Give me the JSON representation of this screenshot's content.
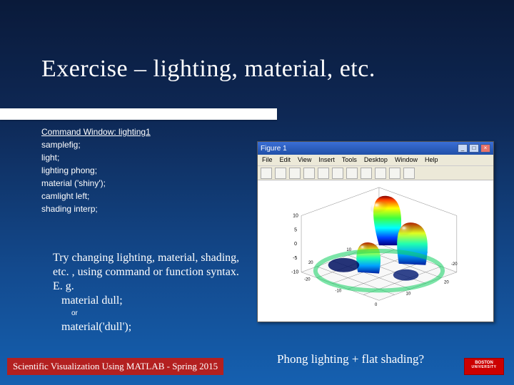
{
  "title": "Exercise – lighting, material, etc.",
  "command_window": {
    "heading": "Command Window: lighting1",
    "lines": [
      "samplefig;",
      "light;",
      "lighting phong;",
      "material ('shiny');",
      "camlight left;",
      "shading interp;"
    ]
  },
  "tip": {
    "body": "Try changing lighting, material, shading, etc. , using command or function syntax.  E. g.",
    "example1": "material dull;",
    "or_label": "or",
    "example2": "material('dull');"
  },
  "figure_window": {
    "title": "Figure 1",
    "menus": [
      "File",
      "Edit",
      "View",
      "Insert",
      "Tools",
      "Desktop",
      "Window",
      "Help"
    ]
  },
  "caption": "Phong lighting + flat shading?",
  "footer": "Scientific Visualization Using MATLAB - Spring 2015",
  "logo": {
    "line1": "BOSTON",
    "line2": "UNIVERSITY"
  },
  "chart_data": {
    "type": "heatmap",
    "description": "3D lit surface plot (peaks-style) rendered in MATLAB figure window with jet colormap, phong lighting, camlight left",
    "xlim": [
      -20,
      20
    ],
    "ylim": [
      -20,
      20
    ],
    "zlim": [
      -10,
      10
    ],
    "xticks": [
      -20,
      -15,
      -10,
      -5,
      0,
      5,
      10,
      15,
      20
    ],
    "yticks": [
      -20,
      -15,
      -10,
      -5,
      0,
      5,
      10,
      15,
      20
    ],
    "zticks": [
      -10,
      -5,
      0,
      5,
      10
    ],
    "colormap": "jet",
    "lighting": "phong",
    "material": "shiny",
    "shading": "interp",
    "camlight": "left"
  }
}
